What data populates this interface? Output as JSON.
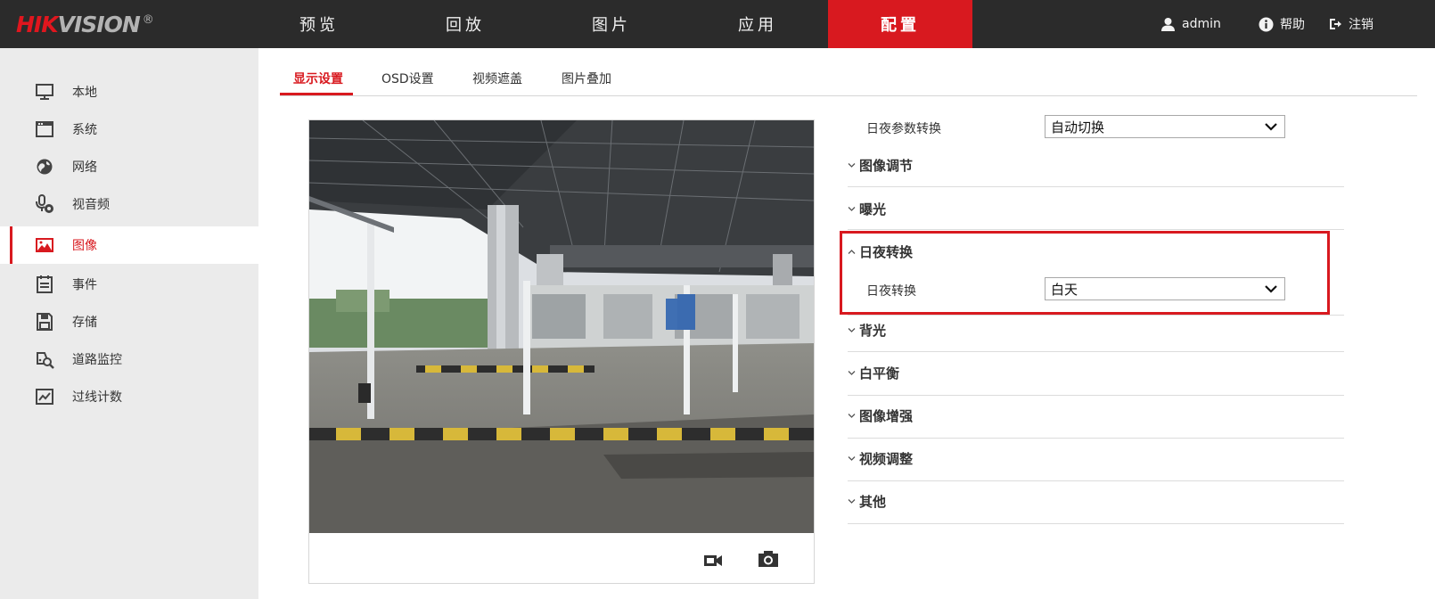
{
  "brand": {
    "hik": "HIK",
    "vision": "VISION",
    "registered": "®"
  },
  "top_nav": [
    {
      "label": "预览"
    },
    {
      "label": "回放"
    },
    {
      "label": "图片"
    },
    {
      "label": "应用"
    },
    {
      "label": "配置",
      "active": true
    }
  ],
  "user": {
    "username": "admin",
    "help": "帮助",
    "logout": "注销"
  },
  "sidebar": {
    "items": [
      {
        "label": "本地",
        "icon": "monitor-icon"
      },
      {
        "label": "系统",
        "icon": "window-icon"
      },
      {
        "label": "网络",
        "icon": "globe-icon"
      },
      {
        "label": "视音频",
        "icon": "microphone-icon"
      },
      {
        "label": "图像",
        "icon": "image-icon",
        "active": true
      },
      {
        "label": "事件",
        "icon": "calendar-icon"
      },
      {
        "label": "存储",
        "icon": "floppy-icon"
      },
      {
        "label": "道路监控",
        "icon": "car-search-icon"
      },
      {
        "label": "过线计数",
        "icon": "chart-icon"
      }
    ]
  },
  "sub_tabs": [
    {
      "label": "显示设置",
      "active": true
    },
    {
      "label": "OSD设置"
    },
    {
      "label": "视频遮盖"
    },
    {
      "label": "图片叠加"
    }
  ],
  "settings": {
    "day_night_param_switch": {
      "label": "日夜参数转换",
      "value": "自动切换"
    },
    "sections": {
      "image_adjust": "图像调节",
      "exposure": "曝光",
      "day_night_switch": "日夜转换",
      "backlight": "背光",
      "white_balance": "白平衡",
      "image_enhance": "图像增强",
      "video_adjust": "视频调整",
      "other": "其他"
    },
    "day_night_switch_field": {
      "label": "日夜转换",
      "value": "白天"
    }
  },
  "colors": {
    "accent": "#d8191f",
    "topbar": "#2b2b2b",
    "sidebar": "#ebebeb"
  }
}
